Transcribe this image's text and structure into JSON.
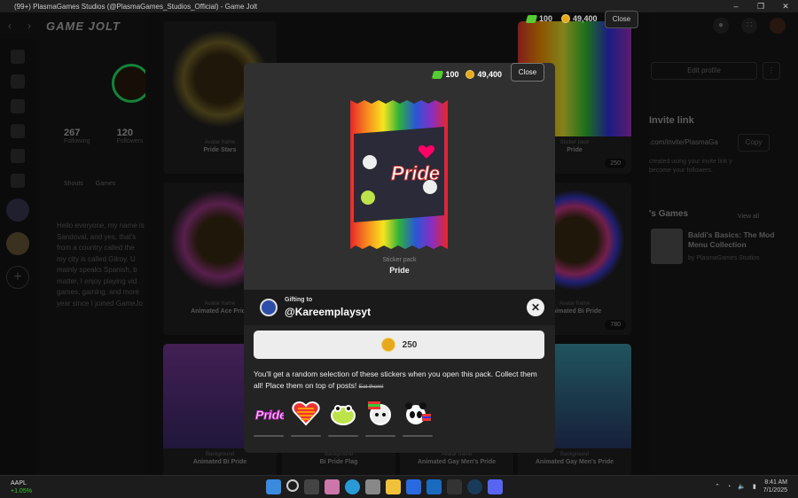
{
  "window": {
    "title": "(99+) PlasmaGames Studios (@PlasmaGames_Studios_Official) - Game Jolt"
  },
  "app": {
    "logo_text": "GAME JOLT"
  },
  "header_wallet": {
    "gems": "100",
    "coins": "49,400",
    "close_label": "Close"
  },
  "profile": {
    "stats": [
      {
        "value": "267",
        "label": "Following"
      },
      {
        "value": "120",
        "label": "Followers"
      }
    ],
    "tabs": [
      "Shouts",
      "Games"
    ],
    "bio": "Hello everyone, my name is Sandoval, and yes, that's from a country called the my city is called Gilroy. U mainly speaks Spanish, b matter, I enjoy playing vid games, gaming, and more year since I joined GameJo"
  },
  "grid_cards": [
    {
      "caption": "Avatar frame",
      "name": "Pride Stars"
    },
    {
      "caption": "Sticker pack",
      "name": "Pride",
      "price": "250"
    },
    {
      "caption": "Avatar frame",
      "name": "Animated Ace Pride"
    },
    {
      "caption": "Avatar frame",
      "name": "Animated Bi Pride",
      "price": "780"
    },
    {
      "caption": "Background",
      "name": "Animated Bi Pride"
    },
    {
      "caption": "Background",
      "name": "Bi Pride Flag"
    },
    {
      "caption": "Avatar frame",
      "name": "Animated Gay Men's Pride"
    },
    {
      "caption": "Background",
      "name": "Animated Gay Men's Pride"
    }
  ],
  "right_panel": {
    "edit_profile": "Edit profile",
    "invite_title": "Invite link",
    "invite_url": ".com/invite/PlasmaGa",
    "copy_label": "Copy",
    "invite_note": "created using your invite link y become your followers.",
    "games_title": "'s Games",
    "view_all": "View all",
    "game_name": "Baldi's Basics: The Mod Menu Collection",
    "game_dev": "by PlasmaGames Studios"
  },
  "modal": {
    "wallet": {
      "gems": "100",
      "coins": "49,400"
    },
    "close_label": "Close",
    "pack_caption": "Sticker pack",
    "pack_name": "Pride",
    "gift_label": "Gifting to",
    "gift_user": "@Kareemplaysyt",
    "price": "250",
    "description": "You'll get a random selection of these stickers when you open this pack. Collect them all! Place them on top of posts!",
    "description_strike": "Eat them!",
    "stickers": [
      "pride-text-sticker",
      "rainbow-heart-sticker",
      "frog-sticker",
      "ghost-flag-sticker",
      "panda-flag-sticker"
    ]
  },
  "taskbar": {
    "stock_symbol": "AAPL",
    "stock_change": "+1.05%",
    "time": "8:41 AM",
    "date": "7/1/2025"
  },
  "colors": {
    "gem": "#55cc33",
    "coin": "#e6a91c",
    "modal_bg": "#232323",
    "accent": "#2d4ea8"
  }
}
